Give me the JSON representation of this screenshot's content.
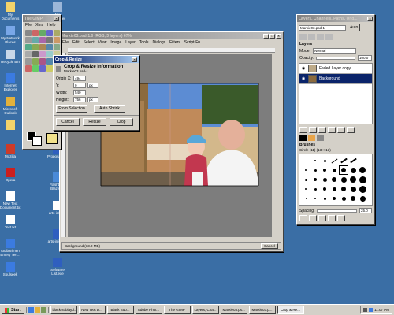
{
  "desktop": {
    "icons": [
      {
        "label": "My Documents",
        "color": "#f2d36b"
      },
      {
        "label": "My Network Places",
        "color": "#79a7e8"
      },
      {
        "label": "Recycle Bin",
        "color": "#c8d7e8"
      },
      {
        "label": "Internet Explorer",
        "color": "#3b7be0"
      },
      {
        "label": "Microsoft Outlook",
        "color": "#e3b13b"
      },
      {
        "label": "",
        "color": "#f2d36b"
      },
      {
        "label": "Mozilla",
        "color": "#cc3b2a"
      },
      {
        "label": "Opera",
        "color": "#cc1f1f"
      },
      {
        "label": "New Text Document.txt",
        "color": "#ffffff"
      },
      {
        "label": "Test.txt",
        "color": "#ffffff"
      },
      {
        "label": "toolbarimen Emery Ten...",
        "color": "#3b7be0"
      },
      {
        "label": "Soulseek",
        "color": "#3b7be0"
      }
    ],
    "icons_col2": [
      {
        "label": "My Computer",
        "color": "#9bb6d8"
      },
      {
        "label": "",
        "color": "#e3b13b"
      },
      {
        "label": "",
        "color": "#e3b13b"
      },
      {
        "label": "",
        "color": "#4a6fb5"
      },
      {
        "label": "Proposal.doc",
        "color": "#2f5fbf"
      },
      {
        "label": "Proposal.doc",
        "color": "#2f5fbf"
      },
      {
        "label": "Flashback BlazePlu",
        "color": "#4a8ad8"
      },
      {
        "label": "arts-info.txt",
        "color": "#ffffff"
      },
      {
        "label": "arts-info.doc",
        "color": "#2f5fbf"
      },
      {
        "label": "Software List.exe",
        "color": "#2f5fbf"
      }
    ]
  },
  "toolbox": {
    "title": "The GIMP",
    "menu": [
      "File",
      "Xtns",
      "Help"
    ]
  },
  "image_window": {
    "title": "Markie03.psd-1.0 (RGB, 3 layers) 67%",
    "menu": [
      "File",
      "Edit",
      "Select",
      "View",
      "Image",
      "Layer",
      "Tools",
      "Dialogs",
      "Filters",
      "Script-Fu"
    ],
    "status": "Background (13.0 MB)",
    "cancel_label": "Cancel"
  },
  "crop_dialog": {
    "title": "Crop & Resize",
    "header": "Crop & Resize Information",
    "subheader": "Markie03.psd-1",
    "origin_x_label": "Origin X:",
    "origin_x": "494",
    "origin_y_label": "Y:",
    "origin_y": "0",
    "width_label": "Width:",
    "width": "540",
    "height_label": "Height:",
    "height": "756",
    "unit": "px",
    "from_selection_label": "From Selection",
    "auto_shrink_label": "Auto Shrink",
    "cancel_label": "Cancel",
    "resize_label": "Resize",
    "crop_label": "Crop"
  },
  "layers_dialog": {
    "title": "Layers, Channels, Paths, Und...",
    "image_name": "Markie03.psd-1",
    "auto_label": "Auto",
    "layers_label": "Layers",
    "mode_label": "Mode:",
    "mode_value": "Normal",
    "opacity_label": "Opacity:",
    "opacity_value": "100.0",
    "layers": [
      {
        "name": "Faded Layer copy",
        "selected": false
      },
      {
        "name": "Background",
        "selected": true
      }
    ],
    "brushes_label": "Brushes",
    "brush_name": "Circle (11) (13 × 13)",
    "spacing_label": "Spacing:",
    "spacing_value": "25.0"
  },
  "taskbar": {
    "start_label": "Start",
    "tasks": [
      {
        "label": "black.sublayd...",
        "active": false
      },
      {
        "label": "New Text D...",
        "active": false
      },
      {
        "label": "Black Sub...",
        "active": false
      },
      {
        "label": "Adobe Phot...",
        "active": false
      },
      {
        "label": "The GIMP",
        "active": false
      },
      {
        "label": "Layers, Cha...",
        "active": false
      },
      {
        "label": "Markie03.ps...",
        "active": false
      },
      {
        "label": "Markie03.p...",
        "active": false
      },
      {
        "label": "Crop & Re...",
        "active": true
      }
    ],
    "clock": "11:07 PM"
  }
}
